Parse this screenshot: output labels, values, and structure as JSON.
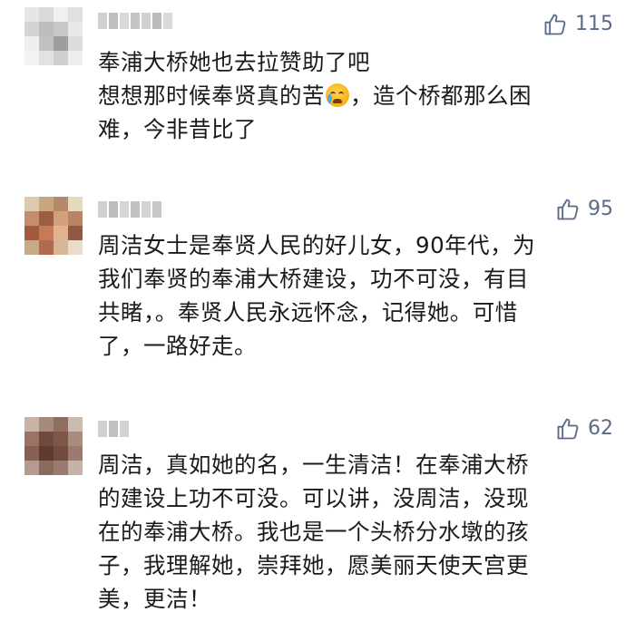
{
  "comments": [
    {
      "likes": "115",
      "lines": [
        "奉浦大桥她也去拉赞助了吧",
        "想想那时候奉贤真的苦",
        "，造个桥都那么困",
        "难，今非昔比了"
      ],
      "emoji_icon": "crying-face-icon"
    },
    {
      "likes": "95",
      "lines": [
        "周洁女士是奉贤人民的好儿女，90年代，为",
        "我们奉贤的奉浦大桥建设，功不可没，有目",
        "共睹，。奉贤人民永远怀念，记得她。可惜",
        "了，一路好走。"
      ]
    },
    {
      "likes": "62",
      "lines": [
        "周洁，真如她的名，一生清洁！在奉浦大桥",
        "的建设上功不可没。可以讲，没周洁，没现",
        "在的奉浦大桥。我也是一个头桥分水墩的孩",
        "子，我理解她，崇拜她，愿美丽天使天宫更",
        "美，更洁！"
      ]
    }
  ],
  "icons": {
    "like": "thumbs-up-icon"
  },
  "colors": {
    "like_text": "#5a6a8a",
    "comment_text": "#1a1a1a"
  }
}
